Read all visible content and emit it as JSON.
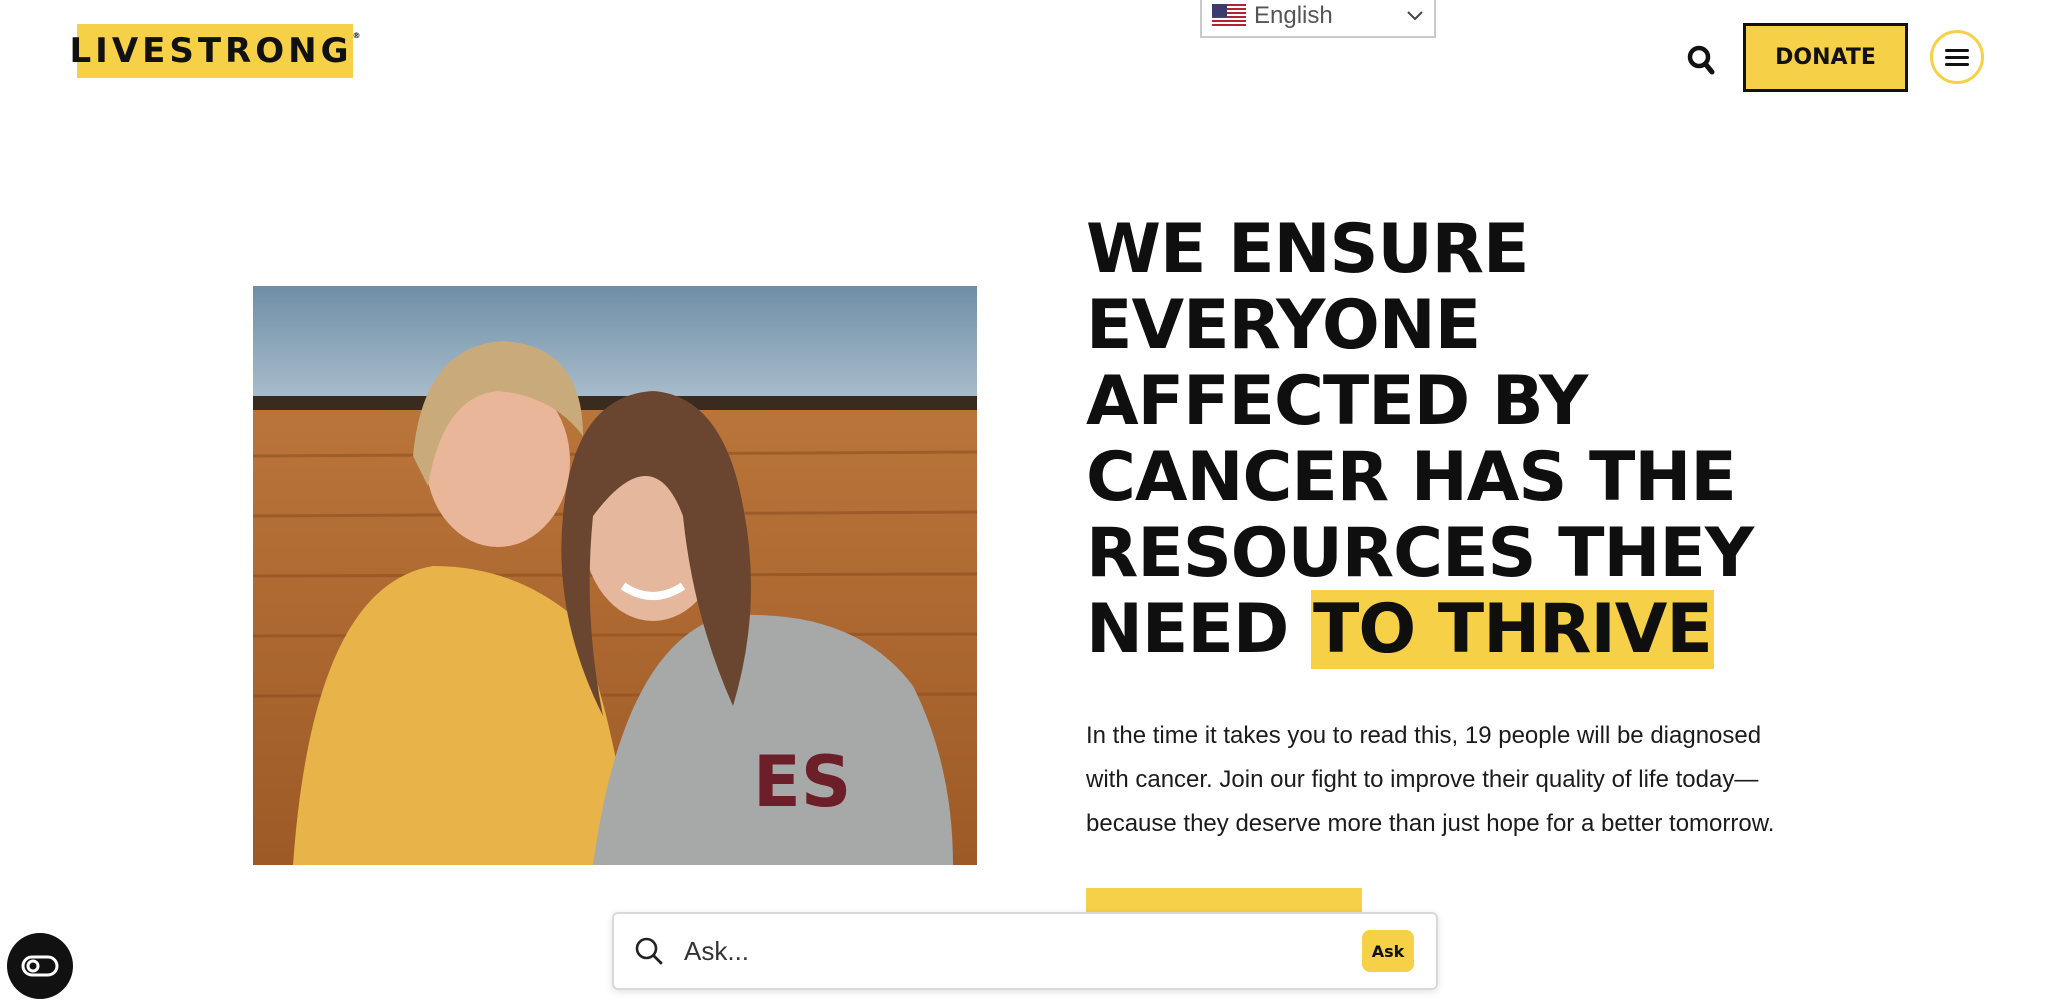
{
  "header": {
    "logo_text": "LIVESTRONG",
    "language": {
      "selected": "English",
      "flag_icon": "us-flag-icon"
    },
    "search_icon": "search-icon",
    "donate_label": "DONATE",
    "menu_icon": "hamburger-menu-icon"
  },
  "hero": {
    "image_alt": "Two women hugging and laughing",
    "headline_lines": [
      "WE ENSURE",
      "EVERYONE",
      "AFFECTED BY",
      "CANCER HAS THE",
      "RESOURCES THEY"
    ],
    "headline_last_plain": "NEED ",
    "headline_highlight": "TO THRIVE",
    "body": "In the time it takes you to read this, 19 people will be diagnosed with cancer. Join our fight to improve their quality of life today—because they deserve more than just hope for a better tomorrow."
  },
  "ask_bar": {
    "placeholder": "Ask...",
    "button_label": "Ask"
  },
  "accessibility_icon": "accessibility-toggle-icon",
  "colors": {
    "brand_yellow": "#f6d046",
    "text_dark": "#111111"
  }
}
